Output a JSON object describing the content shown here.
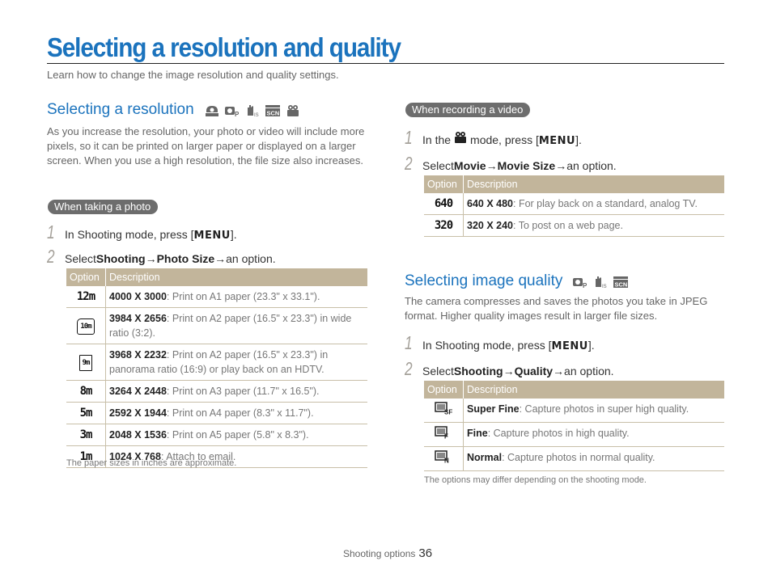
{
  "page": {
    "title": "Selecting a resolution and quality",
    "subtitle": "Learn how to change the image resolution and quality settings."
  },
  "resolution": {
    "heading": "Selecting a resolution",
    "mode_icons": [
      "smart-auto-icon",
      "program-icon",
      "dual-is-icon",
      "scene-icon",
      "movie-icon"
    ],
    "intro": "As you increase the resolution, your photo or video will include more pixels, so it can be printed on larger paper or displayed on a larger screen. When you use a high resolution, the file size also increases.",
    "photo": {
      "badge": "When taking a photo",
      "steps": [
        {
          "num": "1",
          "pre": "In Shooting mode, press [",
          "key": "MENU",
          "post": "]."
        },
        {
          "num": "2",
          "pre": "Select ",
          "b1": "Shooting",
          "arrow1": " → ",
          "b2": "Photo Size",
          "arrow2": " → ",
          "post": "an option."
        }
      ],
      "table": {
        "headers": [
          "Option",
          "Description"
        ],
        "rows": [
          {
            "icon": "12m",
            "icon_name": "12m-resolution-icon",
            "bold": "4000 X 3000",
            "desc": ": Print on A1 paper (23.3\" x 33.1\")."
          },
          {
            "icon": "10m",
            "icon_name": "10m-wide-resolution-icon",
            "bold": "3984 X 2656",
            "desc": ": Print on A2 paper (16.5\" x 23.3\") in wide ratio (3:2)."
          },
          {
            "icon": "9m",
            "icon_name": "9m-panorama-resolution-icon",
            "bold": "3968 X 2232",
            "desc": ": Print on A2 paper (16.5\" x 23.3\") in panorama ratio (16:9) or play back on an HDTV."
          },
          {
            "icon": "8m",
            "icon_name": "8m-resolution-icon",
            "bold": "3264 X 2448",
            "desc": ": Print on A3 paper (11.7\" x 16.5\")."
          },
          {
            "icon": "5m",
            "icon_name": "5m-resolution-icon",
            "bold": "2592 X 1944",
            "desc": ": Print on A4 paper (8.3\" x 11.7\")."
          },
          {
            "icon": "3m",
            "icon_name": "3m-resolution-icon",
            "bold": "2048 X 1536",
            "desc": ": Print on A5 paper (5.8\" x 8.3\")."
          },
          {
            "icon": "1m",
            "icon_name": "1m-resolution-icon",
            "bold": "1024 X 768",
            "desc": ": Attach to email."
          }
        ]
      },
      "note": "The paper sizes in inches are approximate."
    },
    "video": {
      "badge": "When recording a video",
      "steps": [
        {
          "num": "1",
          "pre": "In the ",
          "icon": "movie-icon",
          "mid": " mode, press [",
          "key": "MENU",
          "post": "]."
        },
        {
          "num": "2",
          "pre": "Select ",
          "b1": "Movie",
          "arrow1": " → ",
          "b2": "Movie Size",
          "arrow2": " → ",
          "post": "an option."
        }
      ],
      "table": {
        "headers": [
          "Option",
          "Description"
        ],
        "rows": [
          {
            "icon": "640",
            "icon_name": "640-movie-size-icon",
            "bold": "640 X 480",
            "desc": ": For play back on a standard, analog TV."
          },
          {
            "icon": "320",
            "icon_name": "320-movie-size-icon",
            "bold": "320 X 240",
            "desc": ": To post on a web page."
          }
        ]
      }
    }
  },
  "quality": {
    "heading": "Selecting image quality",
    "mode_icons": [
      "program-icon",
      "dual-is-icon",
      "scene-icon"
    ],
    "intro": "The camera compresses and saves the photos you take in JPEG format. Higher quality images result in larger file sizes.",
    "steps": [
      {
        "num": "1",
        "pre": "In Shooting mode, press [",
        "key": "MENU",
        "post": "]."
      },
      {
        "num": "2",
        "pre": "Select ",
        "b1": "Shooting",
        "arrow1": " → ",
        "b2": "Quality",
        "arrow2": " → ",
        "post": "an option."
      }
    ],
    "table": {
      "headers": [
        "Option",
        "Description"
      ],
      "rows": [
        {
          "icon": "SF",
          "icon_name": "super-fine-quality-icon",
          "bold": "Super Fine",
          "desc": ": Capture photos in super high quality."
        },
        {
          "icon": "F",
          "icon_name": "fine-quality-icon",
          "bold": "Fine",
          "desc": ": Capture photos in high quality."
        },
        {
          "icon": "N",
          "icon_name": "normal-quality-icon",
          "bold": "Normal",
          "desc": ": Capture photos in normal quality."
        }
      ]
    },
    "note": "The options may differ depending on the shooting mode."
  },
  "footer": {
    "section": "Shooting options",
    "page_number": "36"
  },
  "colors": {
    "heading_blue": "#1b73bd",
    "table_header": "#c2b59b",
    "badge_gray": "#6d6d6d"
  }
}
